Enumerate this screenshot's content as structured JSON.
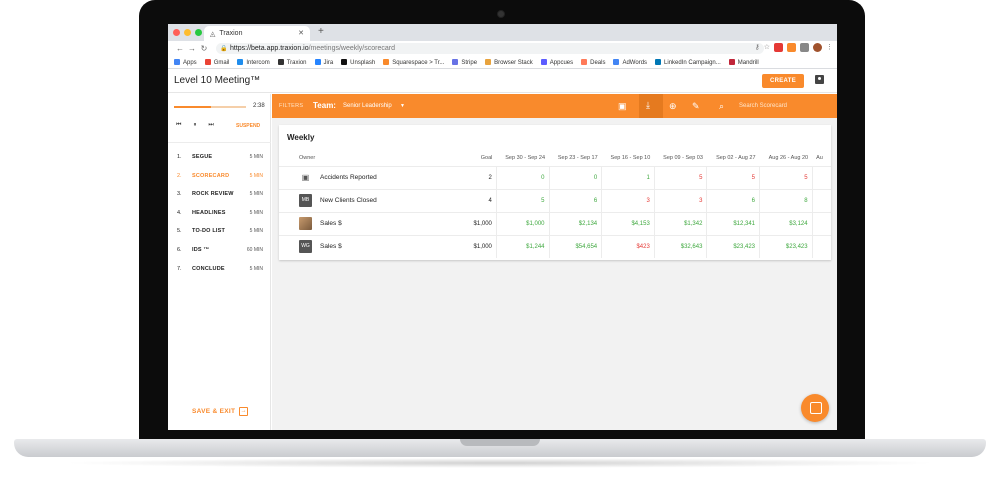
{
  "browser": {
    "tab_title": "Traxion",
    "url_host": "https://beta.app.traxion.io",
    "url_path": "/meetings/weekly/scorecard",
    "bookmarks": [
      {
        "label": "Apps",
        "color": "#4285f4"
      },
      {
        "label": "Gmail",
        "color": "#ea4335"
      },
      {
        "label": "Intercom",
        "color": "#1f8ded"
      },
      {
        "label": "Traxion",
        "color": "#333333"
      },
      {
        "label": "Jira",
        "color": "#2684ff"
      },
      {
        "label": "Unsplash",
        "color": "#111111"
      },
      {
        "label": "Squarespace > Tr...",
        "color": "#f98a2c"
      },
      {
        "label": "Stripe",
        "color": "#6772e5"
      },
      {
        "label": "Browser Stack",
        "color": "#e8a33d"
      },
      {
        "label": "Appcues",
        "color": "#5c5cff"
      },
      {
        "label": "Deals",
        "color": "#ff7a59"
      },
      {
        "label": "AdWords",
        "color": "#4285f4"
      },
      {
        "label": "LinkedIn Campaign...",
        "color": "#0077b5"
      },
      {
        "label": "Mandrill",
        "color": "#c02539"
      }
    ]
  },
  "app": {
    "title": "Level 10 Meeting™",
    "create_label": "CREATE"
  },
  "timer": {
    "value": "2:38",
    "progress": 0.52,
    "suspend_label": "SUSPEND"
  },
  "agenda": [
    {
      "num": "1.",
      "name": "SEGUE",
      "duration": "5 MIN",
      "active": false
    },
    {
      "num": "2.",
      "name": "SCORECARD",
      "duration": "5 MIN",
      "active": true
    },
    {
      "num": "3.",
      "name": "ROCK REVIEW",
      "duration": "5 MIN",
      "active": false
    },
    {
      "num": "4.",
      "name": "HEADLINES",
      "duration": "5 MIN",
      "active": false
    },
    {
      "num": "5.",
      "name": "TO-DO LIST",
      "duration": "5 MIN",
      "active": false
    },
    {
      "num": "6.",
      "name": "IDS ™",
      "duration": "60 MIN",
      "active": false
    },
    {
      "num": "7.",
      "name": "CONCLUDE",
      "duration": "5 MIN",
      "active": false
    }
  ],
  "save_exit_label": "SAVE & EXIT",
  "filterbar": {
    "filters_label": "FILTERS",
    "team_label": "Team:",
    "team_value": "Senior Leadership",
    "search_placeholder": "Search Scorecard"
  },
  "scorecard": {
    "title": "Weekly",
    "owner_header": "Owner",
    "goal_header": "Goal",
    "weeks": [
      "Sep 30 - Sep 24",
      "Sep 23 - Sep 17",
      "Sep 16 - Sep 10",
      "Sep 09 - Sep 03",
      "Sep 02 - Aug 27",
      "Aug 26 - Aug 20",
      "Au"
    ],
    "rows": [
      {
        "avatar": "",
        "avatar_type": "icon",
        "metric": "Accidents Reported",
        "goal": "2",
        "values": [
          {
            "v": "0",
            "c": "green"
          },
          {
            "v": "0",
            "c": "green"
          },
          {
            "v": "1",
            "c": "green"
          },
          {
            "v": "5",
            "c": "red"
          },
          {
            "v": "5",
            "c": "red"
          },
          {
            "v": "5",
            "c": "red"
          }
        ]
      },
      {
        "avatar": "MB",
        "avatar_type": "initials",
        "metric": "New Clients Closed",
        "goal": "4",
        "values": [
          {
            "v": "5",
            "c": "green"
          },
          {
            "v": "6",
            "c": "green"
          },
          {
            "v": "3",
            "c": "red"
          },
          {
            "v": "3",
            "c": "red"
          },
          {
            "v": "6",
            "c": "green"
          },
          {
            "v": "8",
            "c": "green"
          }
        ]
      },
      {
        "avatar": "",
        "avatar_type": "photo",
        "metric": "Sales $",
        "goal": "$1,000",
        "values": [
          {
            "v": "$1,000",
            "c": "green"
          },
          {
            "v": "$2,134",
            "c": "green"
          },
          {
            "v": "$4,153",
            "c": "green"
          },
          {
            "v": "$1,342",
            "c": "green"
          },
          {
            "v": "$12,341",
            "c": "green"
          },
          {
            "v": "$3,124",
            "c": "green"
          }
        ]
      },
      {
        "avatar": "WG",
        "avatar_type": "initials",
        "metric": "Sales $",
        "goal": "$1,000",
        "values": [
          {
            "v": "$1,244",
            "c": "green"
          },
          {
            "v": "$54,654",
            "c": "green"
          },
          {
            "v": "$423",
            "c": "red"
          },
          {
            "v": "$32,643",
            "c": "green"
          },
          {
            "v": "$23,423",
            "c": "green"
          },
          {
            "v": "$23,423",
            "c": "green"
          }
        ]
      }
    ]
  }
}
